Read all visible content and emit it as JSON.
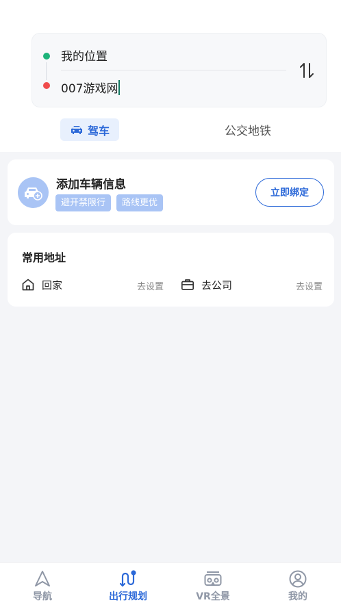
{
  "route": {
    "start": "我的位置",
    "end": "007游戏网"
  },
  "modes": {
    "drive": "驾车",
    "transit": "公交地铁"
  },
  "vehicle": {
    "title": "添加车辆信息",
    "tags": [
      "避开禁限行",
      "路线更优"
    ],
    "bind_label": "立即绑定"
  },
  "common_address": {
    "title": "常用地址",
    "home_label": "回家",
    "home_action": "去设置",
    "work_label": "去公司",
    "work_action": "去设置"
  },
  "nav": {
    "items": [
      {
        "label": "导航"
      },
      {
        "label": "出行规划"
      },
      {
        "label": "VR全景"
      },
      {
        "label": "我的"
      }
    ],
    "active_index": 1
  },
  "colors": {
    "accent": "#2b68d8",
    "start_dot": "#1db37a",
    "end_dot": "#f04c4c",
    "tag_bg": "#a9c4f5"
  }
}
